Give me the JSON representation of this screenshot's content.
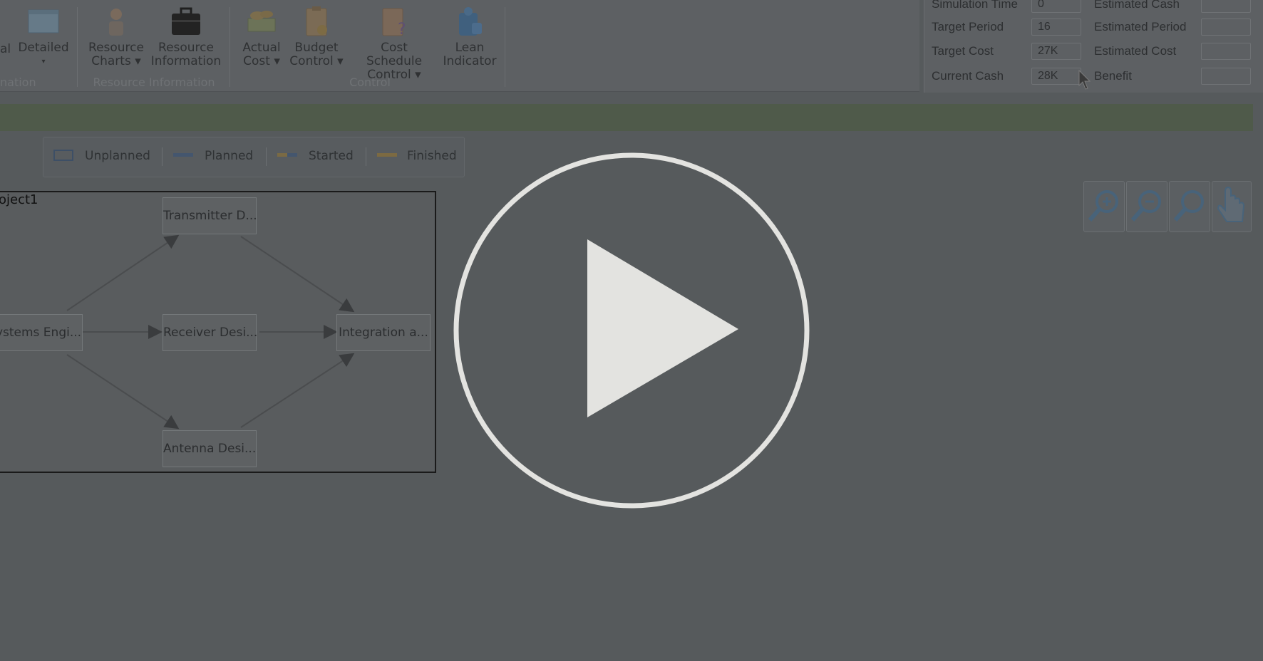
{
  "ribbon": {
    "buttons": [
      {
        "label1": "al",
        "label2": ""
      },
      {
        "label1": "Detailed",
        "label2": "▾"
      },
      {
        "label1": "Resource",
        "label2": "Charts ▾"
      },
      {
        "label1": "Resource",
        "label2": "Information"
      },
      {
        "label1": "Actual",
        "label2": "Cost ▾"
      },
      {
        "label1": "Budget",
        "label2": "Control ▾"
      },
      {
        "label1": "Cost Schedule",
        "label2": "Control ▾"
      },
      {
        "label1": "Lean",
        "label2": "Indicator"
      }
    ],
    "groups": [
      "nation",
      "Resource Information",
      "Control"
    ]
  },
  "stats": {
    "left": [
      {
        "label": "Simulation Time",
        "value": "0"
      },
      {
        "label": "Target Period",
        "value": "16"
      },
      {
        "label": "Target Cost",
        "value": "27K"
      },
      {
        "label": "Current Cash",
        "value": "28K"
      }
    ],
    "right": [
      {
        "label": "Estimated Cash",
        "value": ""
      },
      {
        "label": "Estimated Period",
        "value": ""
      },
      {
        "label": "Estimated Cost",
        "value": ""
      },
      {
        "label": "Benefit",
        "value": ""
      }
    ]
  },
  "legend": {
    "items": [
      {
        "label": "Unplanned"
      },
      {
        "label": "Planned"
      },
      {
        "label": "Started"
      },
      {
        "label": "Finished"
      }
    ]
  },
  "diagram": {
    "title": "oject1",
    "nodes": {
      "transmitter": "Transmitter D...",
      "systems": "ystems Engi...",
      "receiver": "Receiver Desi...",
      "integration": "Integration a...",
      "antenna": "Antenna Desi..."
    }
  },
  "tools": [
    "zoom-in-icon",
    "zoom-out-icon",
    "zoom-fit-icon",
    "pan-hand-icon"
  ],
  "overlay": {
    "icon": "play-icon"
  }
}
